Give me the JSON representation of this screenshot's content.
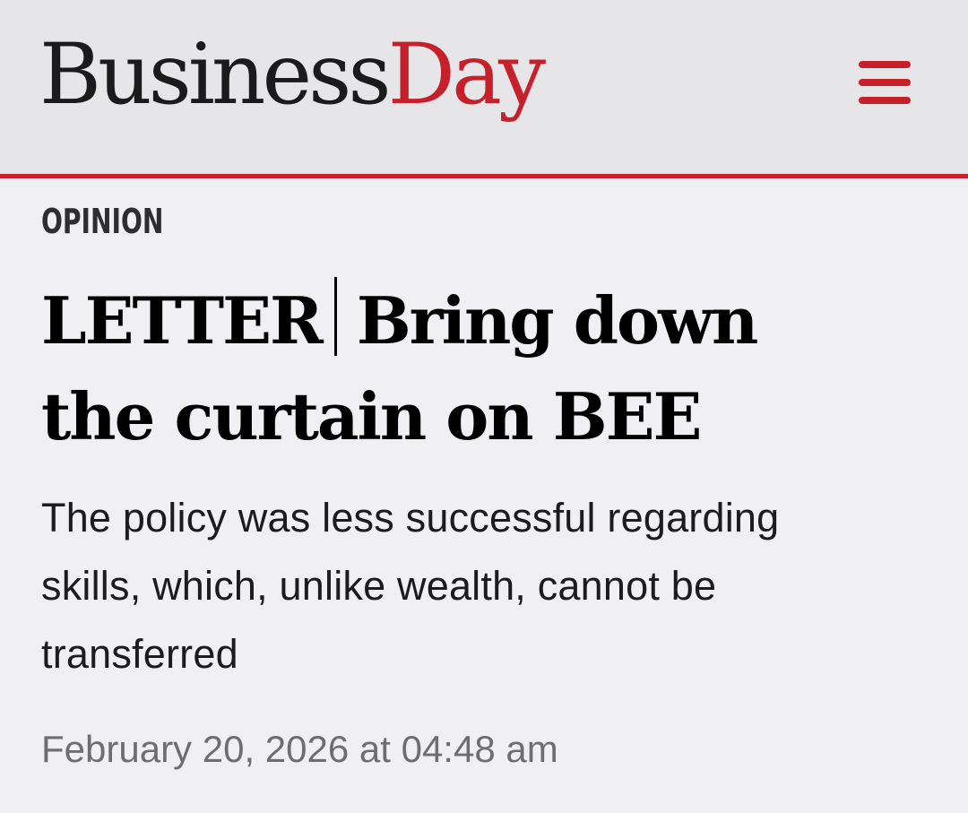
{
  "header": {
    "logo": {
      "part1": "Business",
      "part2": "Day"
    },
    "menu_icon": "hamburger-menu-icon"
  },
  "article": {
    "section": "OPINION",
    "headline": {
      "kicker": "LETTER",
      "line1": "Bring down",
      "line2": "the curtain on BEE"
    },
    "summary": {
      "line1": "The policy was less successful regarding",
      "line2": "skills, which, unlike wealth, cannot be",
      "line3": "transferred"
    },
    "timestamp": "February 20, 2026 at 04:48 am"
  },
  "colors": {
    "brand_red": "#c6202b",
    "header_bg": "#e6e6e9",
    "page_bg": "#efeff4",
    "text_dark": "#1c1b1b",
    "text_muted": "#6d6d72"
  }
}
